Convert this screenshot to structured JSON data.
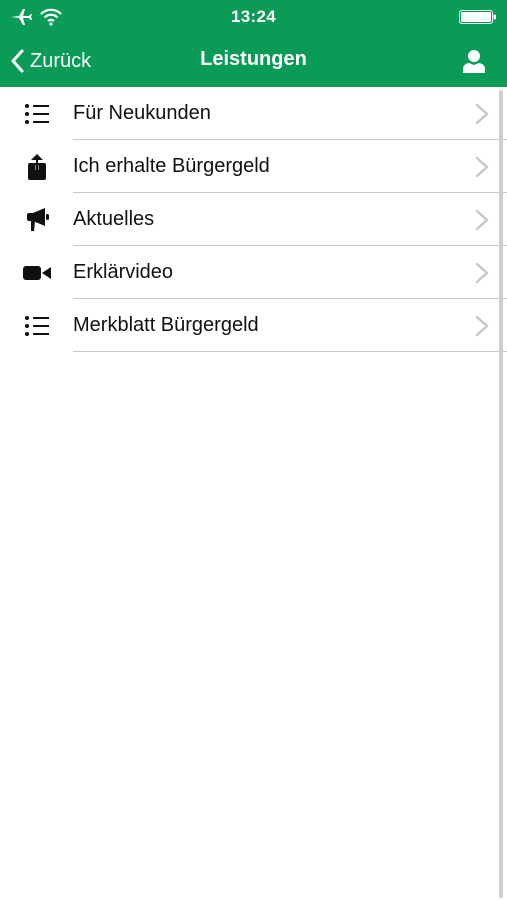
{
  "status_bar": {
    "time": "13:24",
    "icons": [
      "airplane-icon",
      "wifi-icon",
      "battery-icon"
    ]
  },
  "nav": {
    "back_label": "Zurück",
    "title": "Leistungen",
    "profile_icon": "user-icon"
  },
  "colors": {
    "brand_green": "#0a9b57",
    "separator": "#c8c7cc",
    "chevron": "#c7c7cc"
  },
  "menu": {
    "items": [
      {
        "label": "Für Neukunden",
        "icon": "list-icon"
      },
      {
        "label": "Ich erhalte Bürgergeld",
        "icon": "share-icon"
      },
      {
        "label": "Aktuelles",
        "icon": "megaphone-icon"
      },
      {
        "label": "Erklärvideo",
        "icon": "video-camera-icon"
      },
      {
        "label": "Merkblatt Bürgergeld",
        "icon": "list-icon"
      }
    ]
  }
}
